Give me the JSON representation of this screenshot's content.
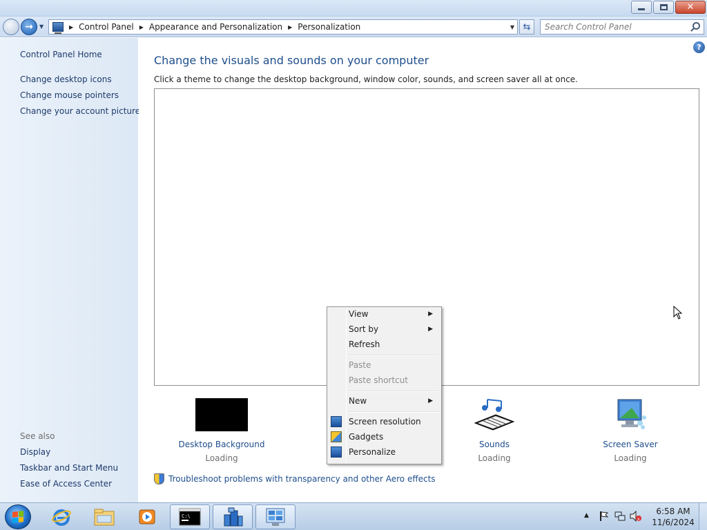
{
  "window": {
    "caption": {
      "minimize_icon": "minimize-icon",
      "maximize_icon": "restore-icon",
      "close_icon": "close-icon"
    }
  },
  "navbar": {
    "breadcrumbs": [
      "Control Panel",
      "Appearance and Personalization",
      "Personalization"
    ],
    "search_placeholder": "Search Control Panel"
  },
  "sidebar": {
    "home": "Control Panel Home",
    "links": [
      "Change desktop icons",
      "Change mouse pointers",
      "Change your account picture"
    ],
    "see_also_label": "See also",
    "see_also": [
      "Display",
      "Taskbar and Start Menu",
      "Ease of Access Center"
    ]
  },
  "main": {
    "title": "Change the visuals and sounds on your computer",
    "subtitle": "Click a theme to change the desktop background, window color, sounds, and screen saver all at once.",
    "items": [
      {
        "label": "Desktop Background",
        "status": "Loading",
        "icon": "desktop-background-icon"
      },
      {
        "label": "Sounds",
        "status": "Loading",
        "icon": "sounds-icon"
      },
      {
        "label": "Screen Saver",
        "status": "Loading",
        "icon": "screen-saver-icon"
      }
    ],
    "troubleshoot": "Troubleshoot problems with transparency and other Aero effects"
  },
  "context_menu": {
    "items": [
      {
        "label": "View",
        "submenu": true,
        "enabled": true
      },
      {
        "label": "Sort by",
        "submenu": true,
        "enabled": true
      },
      {
        "label": "Refresh",
        "submenu": false,
        "enabled": true
      },
      {
        "label": "Paste",
        "submenu": false,
        "enabled": false
      },
      {
        "label": "Paste shortcut",
        "submenu": false,
        "enabled": false
      },
      {
        "label": "New",
        "submenu": true,
        "enabled": true
      },
      {
        "label": "Screen resolution",
        "submenu": false,
        "enabled": true,
        "icon": "monitor-icon"
      },
      {
        "label": "Gadgets",
        "submenu": false,
        "enabled": true,
        "icon": "gadgets-icon"
      },
      {
        "label": "Personalize",
        "submenu": false,
        "enabled": true,
        "icon": "personalize-icon"
      }
    ]
  },
  "taskbar": {
    "pinned": [
      "internet-explorer-icon",
      "windows-explorer-icon",
      "media-player-icon",
      "command-prompt-icon",
      "server-manager-icon",
      "control-panel-icon"
    ],
    "clock_time": "6:58 AM",
    "clock_date": "11/6/2024"
  },
  "colors": {
    "link": "#1e4e8c",
    "leftpane": "#e3edf8",
    "taskbar": "#c5d8ee"
  }
}
